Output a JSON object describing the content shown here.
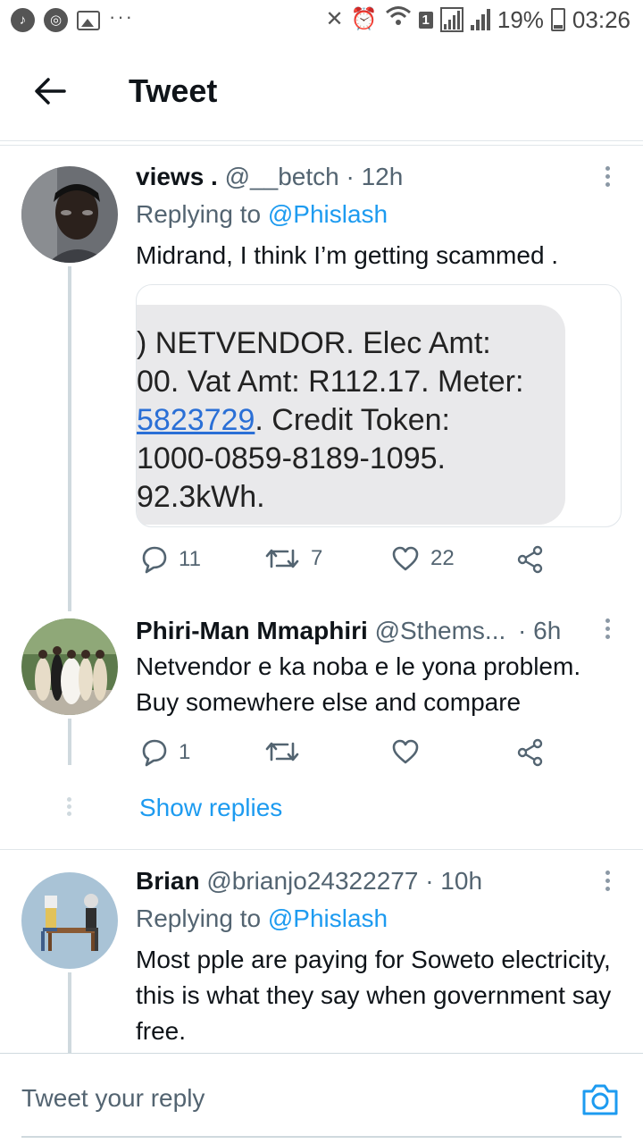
{
  "status_bar": {
    "battery": "19%",
    "time": "03:26",
    "sim_badge": "1",
    "dots": "···"
  },
  "header": {
    "title": "Tweet"
  },
  "tweets": [
    {
      "name": "views .",
      "handle": "@__betch",
      "time": "· 12h",
      "replying_prefix": "Replying to",
      "replying_to": "@Phislash",
      "text": "Midrand, I think I’m getting scammed .",
      "media": {
        "lines": [
          ") NETVENDOR. Elec Amt:",
          "00. Vat Amt: R112.17. Meter:",
          "5823729",
          ". Credit Token:",
          "1000-0859-8189-1095.",
          "92.3kWh."
        ]
      },
      "replies": "11",
      "retweets": "7",
      "likes": "22"
    },
    {
      "name": "Phiri-Man Mmaphiri",
      "handle": "@Sthems...",
      "time": "· 6h",
      "text": "Netvendor e ka noba e le yona problem. Buy somewhere else and compare",
      "replies": "1",
      "show_replies": "Show replies"
    },
    {
      "name": "Brian",
      "handle": "@brianjo24322277",
      "time": "· 10h",
      "replying_prefix": "Replying to",
      "replying_to": "@Phislash",
      "text": "Most pple are paying for Soweto electricity, this is what they say when government say free."
    }
  ],
  "composer": {
    "placeholder": "Tweet your reply"
  },
  "colors": {
    "accent": "#1d9bf0",
    "text": "#0f1419",
    "muted": "#536471",
    "divider": "#e1e6ea"
  }
}
